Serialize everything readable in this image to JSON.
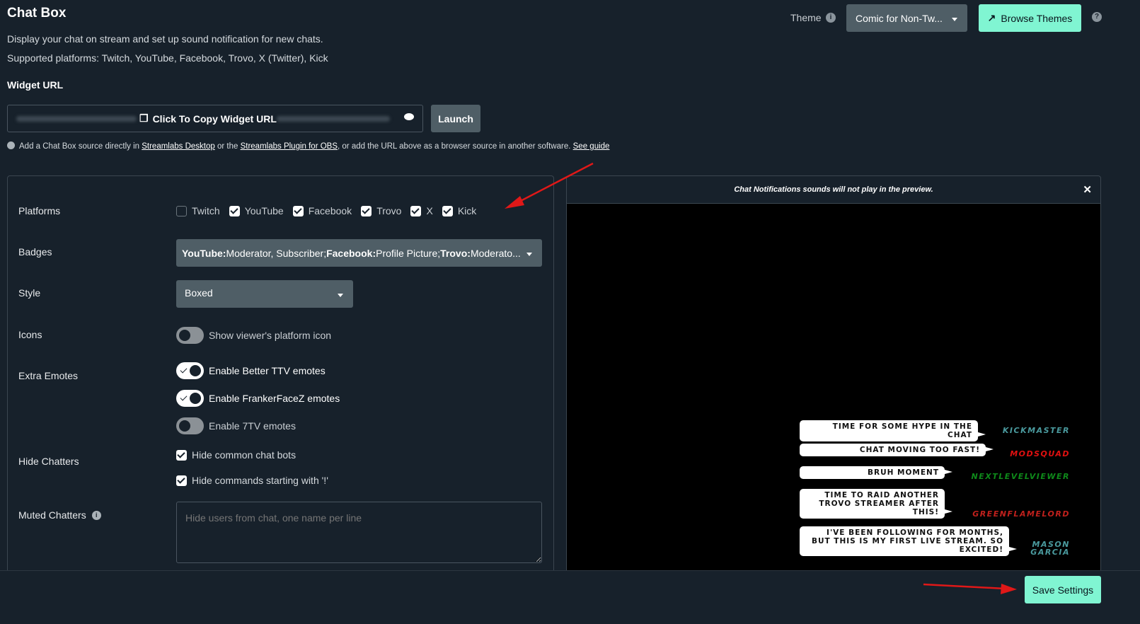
{
  "header": {
    "title": "Chat Box",
    "description": "Display your chat on stream and set up sound notification for new chats.",
    "platforms_text": "Supported platforms: Twitch, YouTube, Facebook, Trovo, X (Twitter), Kick",
    "theme_label": "Theme",
    "theme_value": "Comic for Non-Tw...",
    "browse_themes": "Browse Themes"
  },
  "widget": {
    "label": "Widget URL",
    "copy_label": "Click To Copy Widget URL",
    "launch": "Launch",
    "hint_1": "Add a Chat Box source directly in ",
    "link_desktop": "Streamlabs Desktop",
    "hint_2": " or the ",
    "link_obs": "Streamlabs Plugin for OBS",
    "hint_3": ", or add the URL above as a browser source in another software. ",
    "link_guide": "See guide"
  },
  "form": {
    "platforms_label": "Platforms",
    "platforms": [
      {
        "name": "Twitch",
        "checked": false
      },
      {
        "name": "YouTube",
        "checked": true
      },
      {
        "name": "Facebook",
        "checked": true
      },
      {
        "name": "Trovo",
        "checked": true
      },
      {
        "name": "X",
        "checked": true
      },
      {
        "name": "Kick",
        "checked": true
      }
    ],
    "badges_label": "Badges",
    "badges": {
      "yt_b": "YouTube:",
      "yt": " Moderator, Subscriber; ",
      "fb_b": "Facebook:",
      "fb": " Profile Picture; ",
      "tr_b": "Trovo:",
      "tr": " Moderato..."
    },
    "style_label": "Style",
    "style_value": "Boxed",
    "icons_label": "Icons",
    "icons_toggle": "Show viewer's platform icon",
    "emotes_label": "Extra Emotes",
    "bttv": "Enable Better TTV emotes",
    "ffz": "Enable FrankerFaceZ emotes",
    "seventv": "Enable 7TV emotes",
    "hide_label": "Hide Chatters",
    "hide_bots": "Hide common chat bots",
    "hide_cmds": "Hide commands starting with '!'",
    "muted_label": "Muted Chatters",
    "muted_placeholder": "Hide users from chat, one name per line"
  },
  "preview": {
    "notice": "Chat Notifications sounds will not play in the preview.",
    "messages": [
      {
        "text": "Time for some hype in the chat",
        "user": "KickMaster",
        "color": "#4a9a9e"
      },
      {
        "text": "Chat moving too fast!",
        "user": "ModSquad",
        "color": "#e01010"
      },
      {
        "text": "Bruh moment",
        "user": "NextLevelViewer",
        "color": "#0e8a1a"
      },
      {
        "text": "Time to raid another Trovo streamer after this!",
        "user": "GreenFlameLord",
        "color": "#c0201c"
      },
      {
        "text": "I've been following for months, but this is my first live stream. So excited!",
        "user": "Mason Garcia",
        "color": "#4a9a9e"
      }
    ]
  },
  "footer": {
    "save": "Save Settings"
  },
  "colors": {
    "accent": "#80f5d2",
    "bg": "#17212b"
  }
}
